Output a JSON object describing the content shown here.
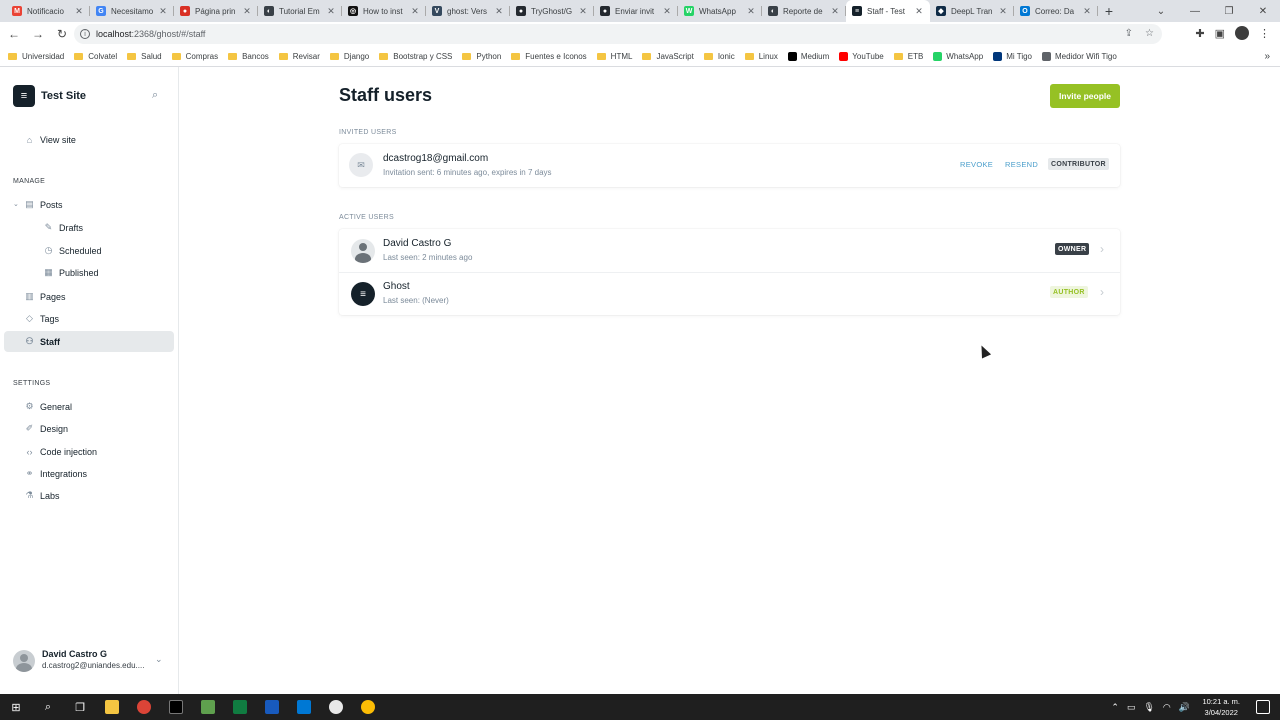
{
  "browser": {
    "tabs": [
      {
        "title": "Notificacio",
        "fav_color": "#ea4335",
        "fav_glyph": "M"
      },
      {
        "title": "Necesitamo",
        "fav_color": "#4285f4",
        "fav_glyph": "G"
      },
      {
        "title": "Página prin",
        "fav_color": "#d93025",
        "fav_glyph": "●"
      },
      {
        "title": "Tutorial Em",
        "fav_color": "#394047",
        "fav_glyph": "◐"
      },
      {
        "title": "How to inst",
        "fav_color": "#111111",
        "fav_glyph": "◎"
      },
      {
        "title": "ghost: Vers",
        "fav_color": "#35495e",
        "fav_glyph": "V"
      },
      {
        "title": "TryGhost/G",
        "fav_color": "#24292f",
        "fav_glyph": "●"
      },
      {
        "title": "Enviar invit",
        "fav_color": "#24292f",
        "fav_glyph": "●"
      },
      {
        "title": "WhatsApp",
        "fav_color": "#25d366",
        "fav_glyph": "W"
      },
      {
        "title": "Reporte de",
        "fav_color": "#394047",
        "fav_glyph": "◐"
      },
      {
        "title": "Staff - Test",
        "fav_color": "#15212a",
        "fav_glyph": "≡",
        "active": true
      },
      {
        "title": "DeepL Tran",
        "fav_color": "#0f2b46",
        "fav_glyph": "◆"
      },
      {
        "title": "Correo: Da",
        "fav_color": "#0078d4",
        "fav_glyph": "O"
      }
    ],
    "new_tab": "+",
    "window_controls": [
      "⌄",
      "—",
      "❐",
      "✕"
    ],
    "url_host": "localhost",
    "url_path": ":2368/ghost/#/staff",
    "bookmarks": [
      {
        "label": "Universidad",
        "type": "folder"
      },
      {
        "label": "Colvatel",
        "type": "folder"
      },
      {
        "label": "Salud",
        "type": "folder"
      },
      {
        "label": "Compras",
        "type": "folder"
      },
      {
        "label": "Bancos",
        "type": "folder"
      },
      {
        "label": "Revisar",
        "type": "folder"
      },
      {
        "label": "Django",
        "type": "folder"
      },
      {
        "label": "Bootstrap y CSS",
        "type": "folder"
      },
      {
        "label": "Python",
        "type": "folder"
      },
      {
        "label": "Fuentes e Iconos",
        "type": "folder"
      },
      {
        "label": "HTML",
        "type": "folder"
      },
      {
        "label": "JavaScript",
        "type": "folder"
      },
      {
        "label": "Ionic",
        "type": "folder"
      },
      {
        "label": "Linux",
        "type": "folder"
      },
      {
        "label": "Medium",
        "type": "site",
        "color": "#000000"
      },
      {
        "label": "YouTube",
        "type": "site",
        "color": "#ff0000"
      },
      {
        "label": "ETB",
        "type": "folder"
      },
      {
        "label": "WhatsApp",
        "type": "site",
        "color": "#25d366"
      },
      {
        "label": "Mi Tigo",
        "type": "site",
        "color": "#00377b"
      },
      {
        "label": "Medidor Wifi Tigo",
        "type": "site",
        "color": "#5f6368"
      }
    ],
    "bookmarks_more": "»"
  },
  "sidebar": {
    "site_name": "Test Site",
    "view_site": "View site",
    "manage_heading": "MANAGE",
    "posts": "Posts",
    "drafts": "Drafts",
    "scheduled": "Scheduled",
    "published": "Published",
    "pages": "Pages",
    "tags": "Tags",
    "staff": "Staff",
    "settings_heading": "SETTINGS",
    "general": "General",
    "design": "Design",
    "code_injection": "Code injection",
    "integrations": "Integrations",
    "labs": "Labs",
    "user_name": "David Castro G",
    "user_email": "d.castrog2@uniandes.edu...."
  },
  "main": {
    "title": "Staff users",
    "invite_button": "Invite people",
    "invited_label": "INVITED USERS",
    "invited": {
      "email": "dcastrog18@gmail.com",
      "meta": "Invitation sent: 6 minutes ago, expires in 7 days",
      "revoke": "REVOKE",
      "resend": "RESEND",
      "role": "CONTRIBUTOR"
    },
    "active_label": "ACTIVE USERS",
    "users": [
      {
        "name": "David Castro G",
        "meta": "Last seen: 2 minutes ago",
        "role": "OWNER"
      },
      {
        "name": "Ghost",
        "meta": "Last seen: (Never)",
        "role": "AUTHOR"
      }
    ]
  },
  "taskbar": {
    "time": "10:21 a. m.",
    "date": "3/04/2022"
  },
  "colors": {
    "accent_green": "#96c124",
    "link_blue": "#4a9ecb",
    "ink": "#15212a"
  }
}
